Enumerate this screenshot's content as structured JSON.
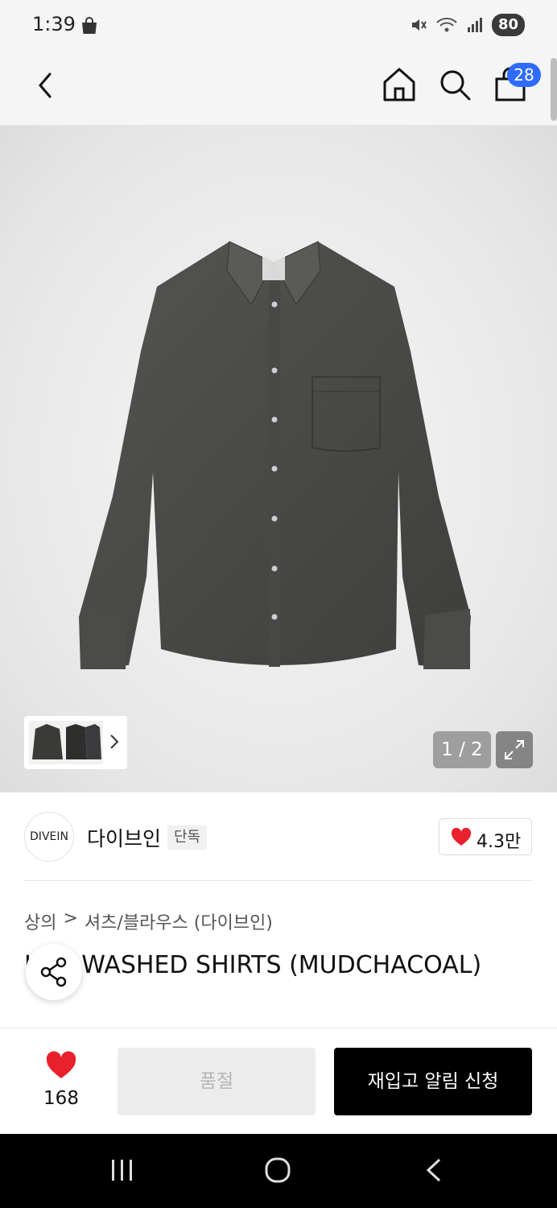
{
  "status_bar": {
    "time": "1:39",
    "battery": "80",
    "icons": [
      "shopping-bag-icon",
      "mute-icon",
      "wifi-icon",
      "signal-icon"
    ]
  },
  "header": {
    "cart_count": "28",
    "icons": [
      "back-icon",
      "home-icon",
      "search-icon",
      "shopping-bag-icon"
    ]
  },
  "gallery": {
    "page_counter": "1 / 2",
    "icons": [
      "chevron-right-icon",
      "expand-icon"
    ]
  },
  "brand": {
    "logo_text": "DIVEIN",
    "name": "다이브인",
    "badge": "단독",
    "likes": "4.3만"
  },
  "product": {
    "breadcrumb": [
      "상의",
      ">",
      "셔츠/블라우스 (다이브인)"
    ],
    "title": "LIFE WASHED SHIRTS (MUDCHACOAL)"
  },
  "actions": {
    "wish_count": "168",
    "soldout_label": "품절",
    "restock_label": "재입고 알림 신청"
  },
  "colors": {
    "accent_red": "#e8212d",
    "badge_blue": "#2f6bff",
    "shirt": "#4a4a48"
  }
}
